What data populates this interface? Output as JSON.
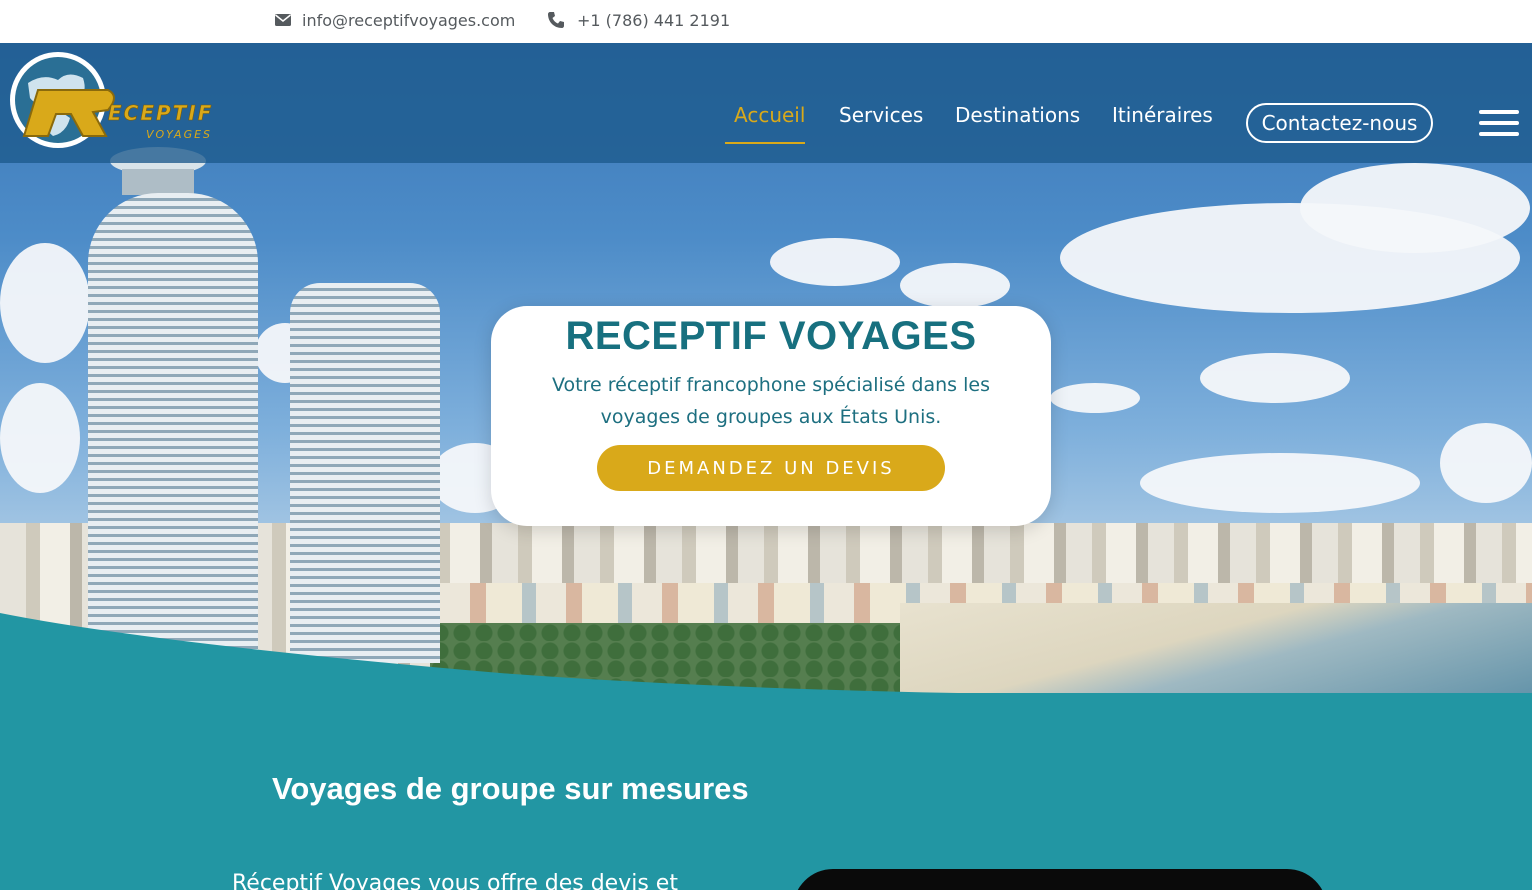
{
  "topbar": {
    "email": "info@receptifvoyages.com",
    "phone": "+1 (786) 441 2191",
    "email_icon": "envelope-icon",
    "phone_icon": "phone-icon"
  },
  "header": {
    "logo": {
      "brand_text": "RECEPTIF",
      "brand_sub": "VOYAGES"
    },
    "nav": {
      "home": "Accueil",
      "services": "Services",
      "destinations": "Destinations",
      "itineraries": "Itinéraires",
      "contact": "Contactez-nous"
    },
    "menu_icon": "hamburger-menu-icon"
  },
  "hero": {
    "title": "RECEPTIF VOYAGES",
    "subtitle": "Votre réceptif francophone spécialisé dans les voyages de groupes aux États Unis.",
    "cta": "DEMANDEZ UN DEVIS"
  },
  "section": {
    "heading": "Voyages de groupe sur mesures",
    "paragraph_start": "Réceptif Voyages vous offre des devis et"
  },
  "colors": {
    "teal": "#2296a3",
    "gold": "#d9a91a",
    "title_teal": "#17707f",
    "header_blue": "#1c5a8c"
  }
}
